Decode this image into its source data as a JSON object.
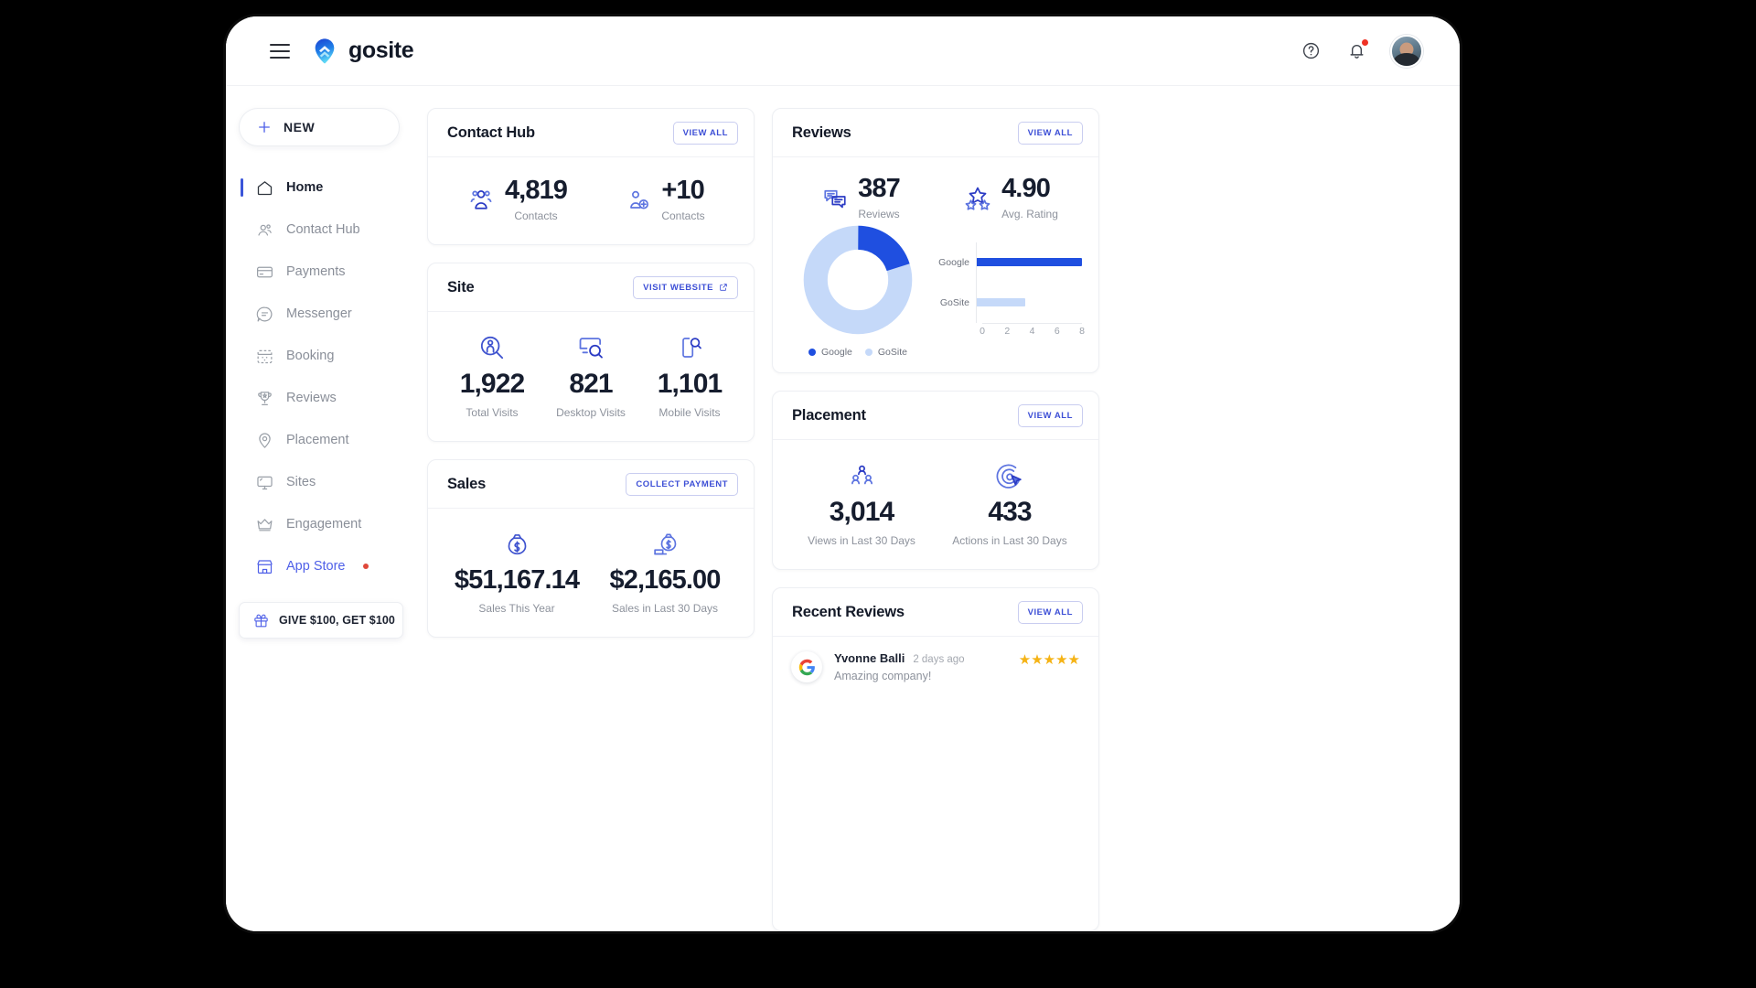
{
  "brand": {
    "name": "gosite"
  },
  "topbar": {
    "menu_icon": "hamburger-icon",
    "help_icon": "help-circle-icon",
    "notifications_icon": "bell-icon",
    "avatar": "user-avatar"
  },
  "sidebar": {
    "new_button": {
      "label": "NEW",
      "icon": "plus-icon"
    },
    "items": [
      {
        "label": "Home",
        "icon": "home-icon",
        "active": true
      },
      {
        "label": "Contact Hub",
        "icon": "people-icon",
        "active": false
      },
      {
        "label": "Payments",
        "icon": "credit-card-icon",
        "active": false
      },
      {
        "label": "Messenger",
        "icon": "chat-bubble-icon",
        "active": false
      },
      {
        "label": "Booking",
        "icon": "calendar-icon",
        "active": false
      },
      {
        "label": "Reviews",
        "icon": "trophy-icon",
        "active": false
      },
      {
        "label": "Placement",
        "icon": "map-pin-icon",
        "active": false
      },
      {
        "label": "Sites",
        "icon": "monitor-icon",
        "active": false
      },
      {
        "label": "Engagement",
        "icon": "crown-icon",
        "active": false
      },
      {
        "label": "App Store",
        "icon": "store-icon",
        "active": false,
        "accent": true,
        "dot": true
      }
    ],
    "referral_button": {
      "label": "GIVE $100, GET $100",
      "icon": "gift-icon"
    }
  },
  "cards": {
    "contact_hub": {
      "title": "Contact Hub",
      "action": "VIEW ALL",
      "stats": [
        {
          "value": "4,819",
          "label": "Contacts",
          "icon": "group-contacts-icon"
        },
        {
          "value": "+10",
          "label": "Contacts",
          "icon": "add-contact-icon"
        }
      ]
    },
    "site": {
      "title": "Site",
      "action": "VISIT WEBSITE",
      "action_icon": "external-link-icon",
      "stats": [
        {
          "value": "1,922",
          "label": "Total Visits",
          "icon": "visitor-search-icon"
        },
        {
          "value": "821",
          "label": "Desktop Visits",
          "icon": "desktop-search-icon"
        },
        {
          "value": "1,101",
          "label": "Mobile Visits",
          "icon": "mobile-search-icon"
        }
      ]
    },
    "sales": {
      "title": "Sales",
      "action": "COLLECT PAYMENT",
      "stats": [
        {
          "value": "$51,167.14",
          "label": "Sales This Year",
          "icon": "money-bag-icon"
        },
        {
          "value": "$2,165.00",
          "label": "Sales in Last 30 Days",
          "icon": "money-payment-icon"
        }
      ]
    },
    "reviews": {
      "title": "Reviews",
      "action": "VIEW ALL",
      "stats": [
        {
          "value": "387",
          "label": "Reviews",
          "icon": "review-bubbles-icon"
        },
        {
          "value": "4.90",
          "label": "Avg. Rating",
          "icon": "stars-icon"
        }
      ]
    },
    "placement": {
      "title": "Placement",
      "action": "VIEW ALL",
      "stats": [
        {
          "value": "3,014",
          "label": "Views in Last 30 Days",
          "icon": "audience-icon"
        },
        {
          "value": "433",
          "label": "Actions in Last 30 Days",
          "icon": "click-target-icon"
        }
      ]
    },
    "recent_reviews": {
      "title": "Recent Reviews",
      "action": "VIEW ALL",
      "items": [
        {
          "source_icon": "google-logo-icon",
          "name": "Yvonne Balli",
          "time": "2 days ago",
          "text": "Amazing company!",
          "rating": 5,
          "stars": "★★★★★"
        }
      ]
    }
  },
  "colors": {
    "google_blue": "#1f4fe0",
    "gosite_blue": "#c5d9f9",
    "accent": "#3d4fd6",
    "star_gold": "#f5b315",
    "alert_red": "#ef3124"
  },
  "chart_data": [
    {
      "type": "pie",
      "title": "Reviews by source",
      "labels": [
        "Google",
        "GoSite"
      ],
      "values": [
        20,
        80
      ],
      "colors": [
        "#1f4fe0",
        "#c5d9f9"
      ],
      "legend": "bottom",
      "donut": true
    },
    {
      "type": "bar",
      "title": "Reviews by source",
      "orientation": "horizontal",
      "categories": [
        "Google",
        "GoSite"
      ],
      "values": [
        8,
        3.7
      ],
      "colors": [
        "#1f4fe0",
        "#c5d9f9"
      ],
      "xlabel": "",
      "ylabel": "",
      "xlim": [
        0,
        8
      ],
      "xticks": [
        0,
        2,
        4,
        6,
        8
      ],
      "grid": true
    }
  ]
}
